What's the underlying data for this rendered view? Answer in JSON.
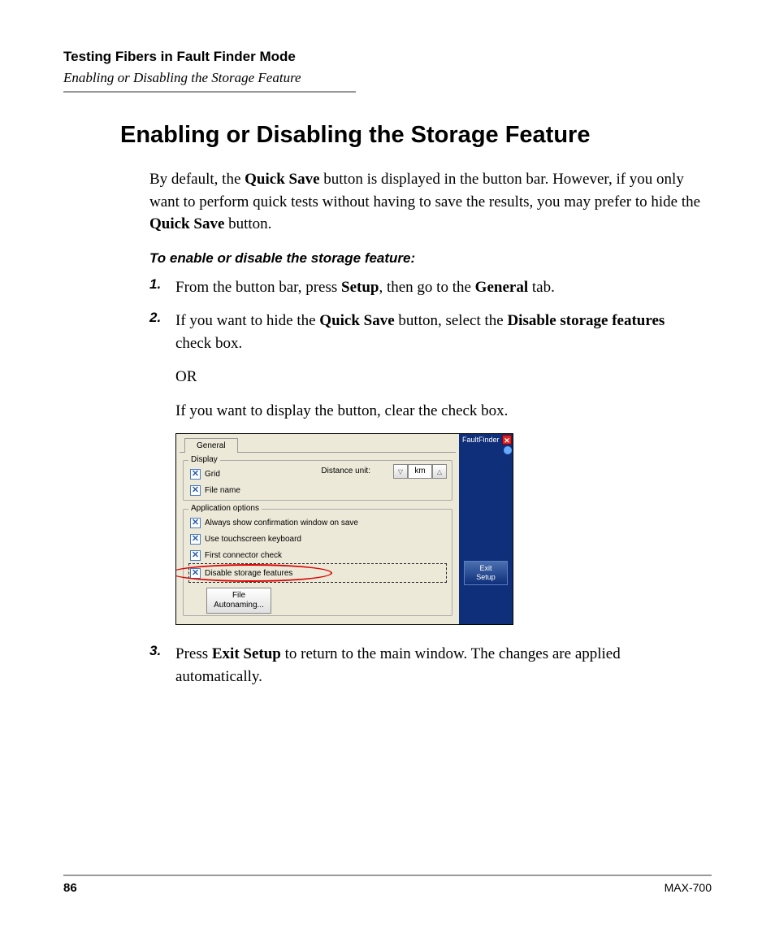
{
  "header": {
    "chapter": "Testing Fibers in Fault Finder Mode",
    "section": "Enabling or Disabling the Storage Feature"
  },
  "heading": "Enabling or Disabling the Storage Feature",
  "intro": {
    "pre1": "By default, the ",
    "bold1": "Quick Save",
    "mid1": " button is displayed in the button bar. However, if you only want to perform quick tests without having to save the results, you may prefer to hide the ",
    "bold2": "Quick Save",
    "post1": " button."
  },
  "subheading": "To enable or disable the storage feature:",
  "steps": {
    "s1": {
      "num": "1.",
      "pre": "From the button bar, press ",
      "b1": "Setup",
      "mid": ", then go to the ",
      "b2": "General",
      "post": " tab."
    },
    "s2": {
      "num": "2.",
      "pre": "If you want to hide the ",
      "b1": "Quick Save",
      "mid": " button, select the ",
      "b2": "Disable storage features",
      "post": " check box.",
      "or": "OR",
      "line2": "If you want to display the button, clear the check box."
    },
    "s3": {
      "num": "3.",
      "pre": "Press ",
      "b1": "Exit Setup",
      "post": " to return to the main window. The changes are applied automatically."
    }
  },
  "figure": {
    "tab": "General",
    "group_display": "Display",
    "grid": "Grid",
    "filename": "File name",
    "distance_unit_label": "Distance unit:",
    "distance_unit_value": "km",
    "group_app": "Application options",
    "opt_confirm": "Always show confirmation window on save",
    "opt_keyboard": "Use touchscreen keyboard",
    "opt_connector": "First connector check",
    "opt_disable": "Disable storage features",
    "file_btn_l1": "File",
    "file_btn_l2": "Autonaming...",
    "right_title": "FaultFinder",
    "exit_l1": "Exit",
    "exit_l2": "Setup"
  },
  "footer": {
    "page": "86",
    "model": "MAX-700"
  }
}
